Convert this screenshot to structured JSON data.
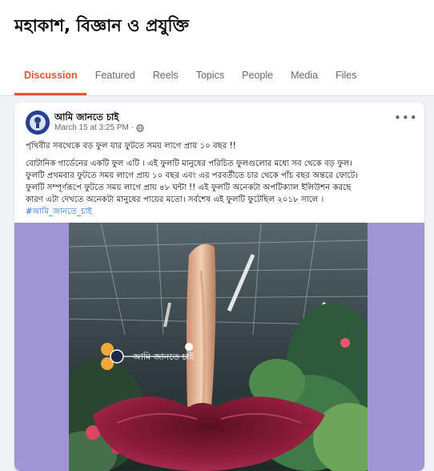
{
  "group": {
    "title": "মহাকাশ, বিজ্ঞান ও প্রযুক্তি"
  },
  "tabs": [
    {
      "label": "Discussion",
      "active": true
    },
    {
      "label": "Featured"
    },
    {
      "label": "Reels"
    },
    {
      "label": "Topics"
    },
    {
      "label": "People"
    },
    {
      "label": "Media"
    },
    {
      "label": "Files"
    }
  ],
  "post": {
    "author": "আমি জানতে চাই",
    "timestamp": "March 15 at 3:25 PM",
    "privacy_icon": "globe-icon",
    "more_label": "•••",
    "headline": "পৃথিবীর সবথেকে বড় ফুল যার ফুটতে সময় লাগে প্রায় ১০ বছর !!",
    "lines": [
      "বোটানিক গার্ডেনের একটি ফুল এটি । এই ফুলটি মানুষের পরিচিত ফুলগুলোর মধ্যে সব থেকে বড় ফুল।",
      "ফুলটি প্রথমবার ফুটতে সময় লাগে প্রায় ১০ বছর এবং এর পরবর্তীতে চার থেকে পাঁচ বছর অন্তরে ফোটে।",
      "ফুলটি সম্পূর্ণরূপে ফুটতে সময় লাগে প্রায় ৪৮ ঘন্টা !! এই ফুলটি অনেকটা অপটিক্যাল ইলিউশন করছে",
      "কারণ এটা দেখতে অনেকটা মানুষের পায়ের মতো। সর্বশেষ এই ফুলটি ফুটেছিল ২০১৮ সালে ।"
    ],
    "hashtag": "#আমি_জানতে_চাই",
    "watermark": "আমি জানতে চাই"
  },
  "colors": {
    "accent": "#e4572e",
    "link": "#216fdb",
    "media_background": "#9f95d4"
  }
}
